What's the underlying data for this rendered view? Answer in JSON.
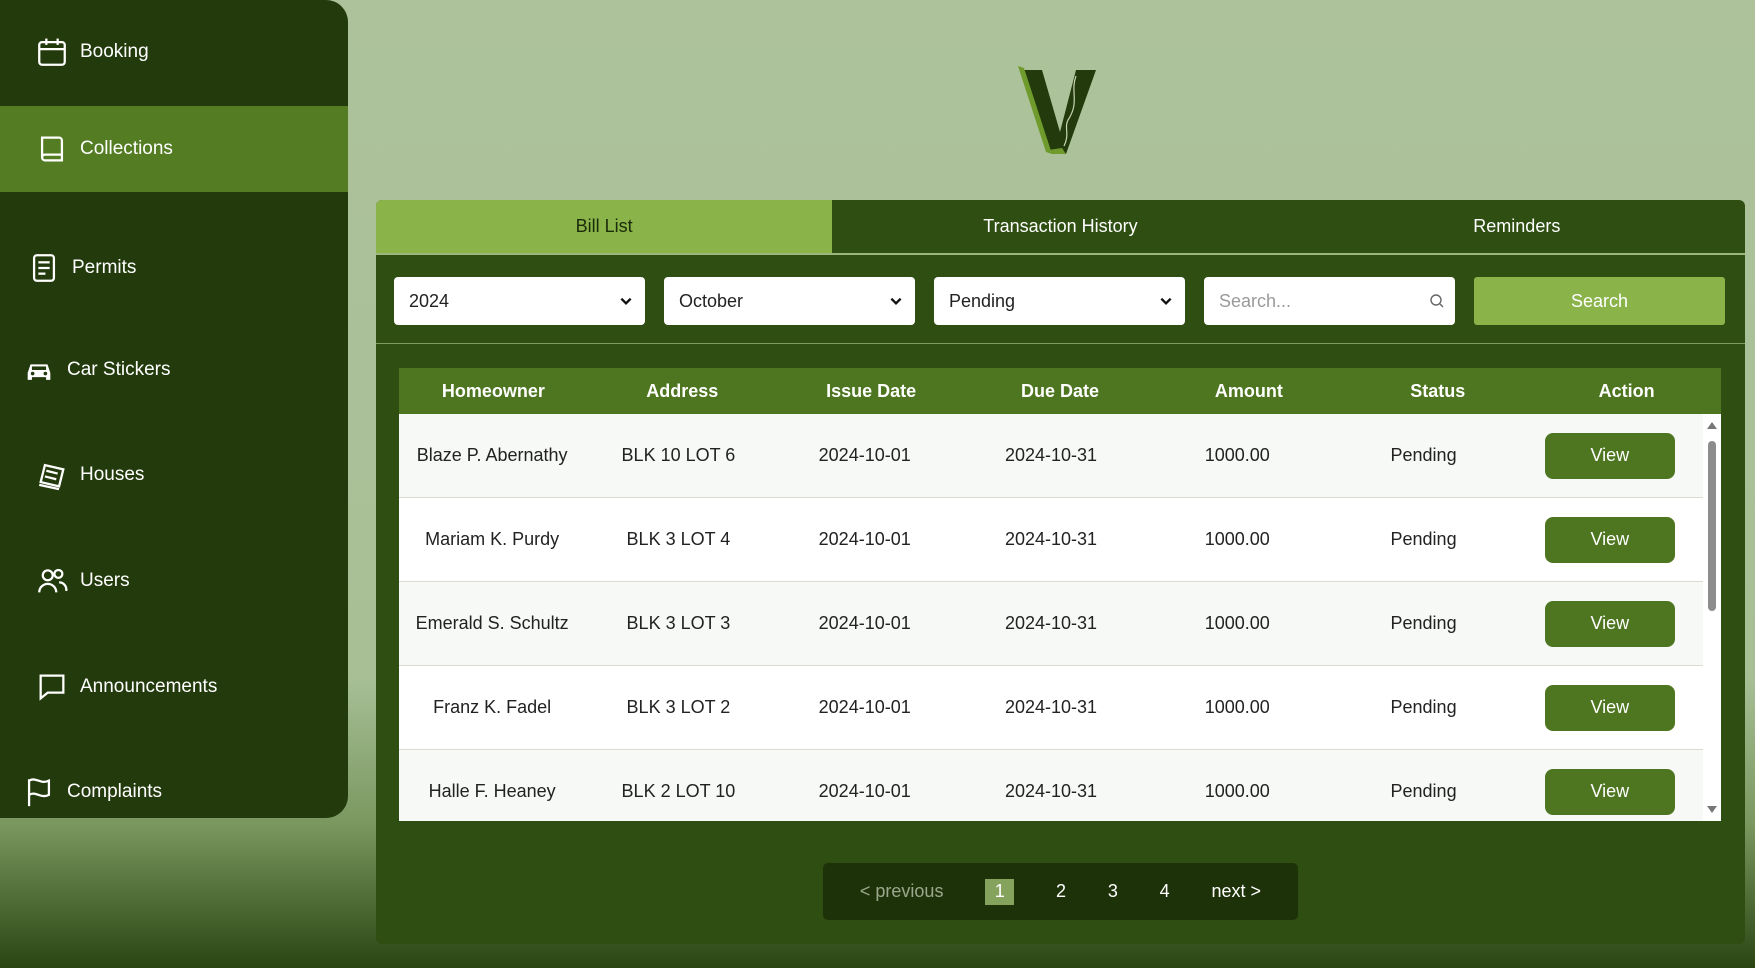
{
  "sidebar": {
    "items": [
      {
        "label": "Booking",
        "icon": "calendar-icon"
      },
      {
        "label": "Collections",
        "icon": "book-icon"
      },
      {
        "label": "Permits",
        "icon": "document-icon"
      },
      {
        "label": "Car Stickers",
        "icon": "car-icon"
      },
      {
        "label": "Houses",
        "icon": "houses-icon"
      },
      {
        "label": "Users",
        "icon": "users-icon"
      },
      {
        "label": "Announcements",
        "icon": "chat-icon"
      },
      {
        "label": "Complaints",
        "icon": "flag-icon"
      }
    ],
    "active": "Collections"
  },
  "tabs": [
    {
      "label": "Bill List"
    },
    {
      "label": "Transaction History"
    },
    {
      "label": "Reminders"
    }
  ],
  "filters": {
    "year": "2024",
    "month": "October",
    "status": "Pending",
    "search_placeholder": "Search...",
    "search_button": "Search"
  },
  "table": {
    "headers": [
      "Homeowner",
      "Address",
      "Issue Date",
      "Due Date",
      "Amount",
      "Status",
      "Action"
    ],
    "rows": [
      [
        "Blaze P. Abernathy",
        "BLK 10 LOT 6",
        "2024-10-01",
        "2024-10-31",
        "1000.00",
        "Pending",
        "View"
      ],
      [
        "Mariam K. Purdy",
        "BLK 3 LOT 4",
        "2024-10-01",
        "2024-10-31",
        "1000.00",
        "Pending",
        "View"
      ],
      [
        "Emerald S. Schultz",
        "BLK 3 LOT 3",
        "2024-10-01",
        "2024-10-31",
        "1000.00",
        "Pending",
        "View"
      ],
      [
        "Franz K. Fadel",
        "BLK 3 LOT 2",
        "2024-10-01",
        "2024-10-31",
        "1000.00",
        "Pending",
        "View"
      ],
      [
        "Halle F. Heaney",
        "BLK 2 LOT 10",
        "2024-10-01",
        "2024-10-31",
        "1000.00",
        "Pending",
        "View"
      ]
    ]
  },
  "pagination": {
    "previous": "< previous",
    "pages": [
      "1",
      "2",
      "3",
      "4"
    ],
    "current": "1",
    "next": "next >"
  },
  "colors": {
    "sidebar_bg": "#223a0c",
    "sidebar_active": "#537c23",
    "panel_bg": "#2f4e12",
    "accent": "#8ab34a",
    "table_header": "#4e7520"
  }
}
